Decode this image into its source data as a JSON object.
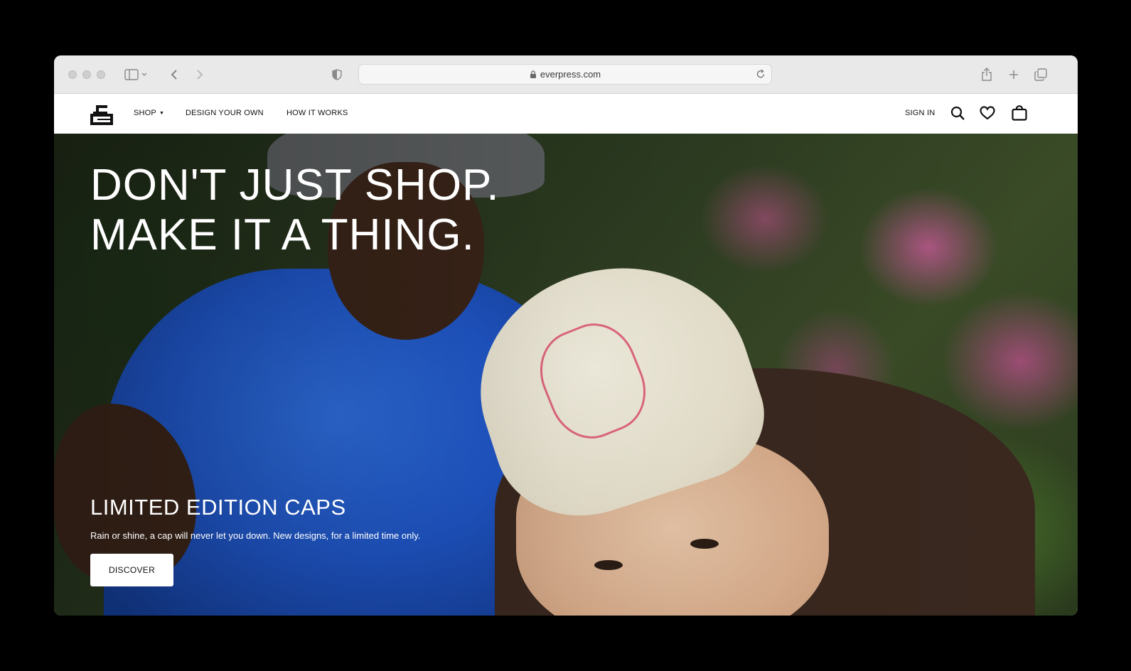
{
  "browser": {
    "url": "everpress.com",
    "icons": {
      "sidebar": "sidebar-icon",
      "back": "chevron-left-icon",
      "forward": "chevron-right-icon",
      "privacy": "shield-icon",
      "lock": "lock-icon",
      "reload": "reload-icon",
      "share": "share-icon",
      "new_tab": "plus-icon",
      "tabs": "tabs-overview-icon"
    }
  },
  "site_nav": {
    "logo": "everpress-logo",
    "links": [
      {
        "label": "SHOP",
        "has_dropdown": true
      },
      {
        "label": "DESIGN YOUR OWN"
      },
      {
        "label": "HOW IT WORKS"
      }
    ],
    "sign_in": "SIGN IN",
    "icons": {
      "search": "search-icon",
      "wishlist": "heart-icon",
      "bag": "shopping-bag-icon"
    }
  },
  "hero": {
    "headline_line1": "DON'T JUST SHOP.",
    "headline_line2": "MAKE IT A THING.",
    "title": "LIMITED EDITION CAPS",
    "description": "Rain or shine, a cap will never let you down. New designs, for a limited time only.",
    "cta_label": "DISCOVER"
  },
  "colors": {
    "background": "#000000",
    "chrome": "#e9e9e9",
    "nav_background": "#ffffff",
    "text_dark": "#111111",
    "hero_text": "#ffffff",
    "hoodie_blue": "#1f56c8"
  }
}
